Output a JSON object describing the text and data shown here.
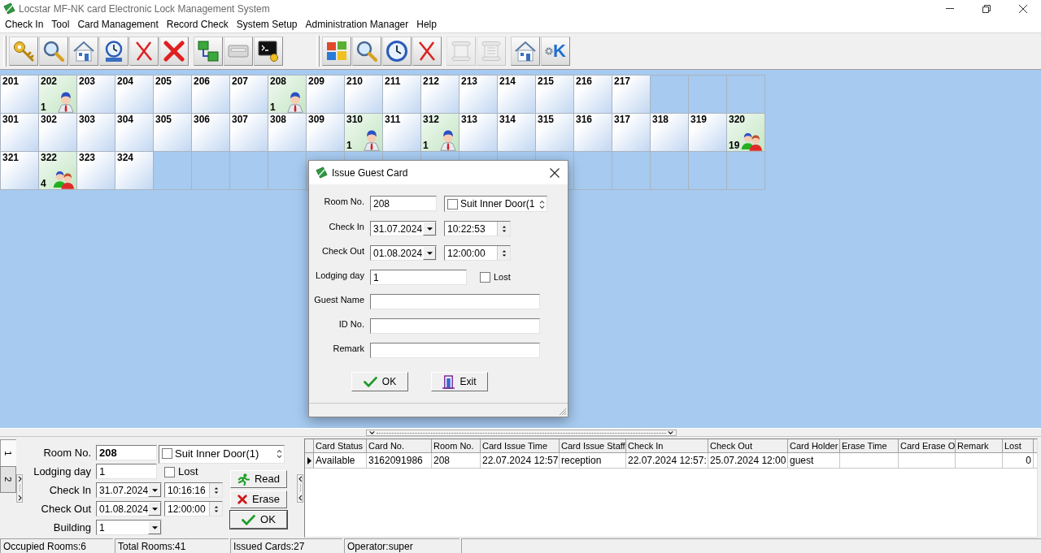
{
  "window": {
    "title": "Locstar MF-NK card Electronic Lock Management System"
  },
  "menu": [
    "Check In",
    "Tool",
    "Card Management",
    "Record Check",
    "System Setup",
    "Administration Manager",
    "Help"
  ],
  "toolbar": [
    {
      "groups": [
        [
          {
            "kind": "keys",
            "disabled": false
          },
          {
            "kind": "search",
            "disabled": false
          },
          {
            "kind": "house",
            "disabled": false
          },
          {
            "kind": "clock-tag",
            "disabled": false
          },
          {
            "kind": "cross-thin",
            "disabled": false
          },
          {
            "kind": "cross-bold",
            "disabled": false
          }
        ],
        [
          {
            "kind": "network",
            "disabled": false
          },
          {
            "kind": "card",
            "disabled": false
          },
          {
            "kind": "terminal",
            "disabled": false
          }
        ]
      ]
    },
    {
      "groups": [
        [
          {
            "kind": "windows",
            "disabled": false
          },
          {
            "kind": "search",
            "disabled": false
          },
          {
            "kind": "clock",
            "disabled": false
          },
          {
            "kind": "cross-thin",
            "disabled": false
          }
        ],
        [
          {
            "kind": "scroll",
            "disabled": true
          },
          {
            "kind": "scroll-list",
            "disabled": true
          }
        ],
        [
          {
            "kind": "house",
            "disabled": false
          },
          {
            "kind": "k-gear",
            "label": "K",
            "disabled": false
          }
        ]
      ]
    }
  ],
  "rooms": [
    [
      {
        "number": "201",
        "kind": "vacant"
      },
      {
        "number": "202",
        "kind": "single",
        "count": "1"
      },
      {
        "number": "203",
        "kind": "vacant"
      },
      {
        "number": "204",
        "kind": "vacant"
      },
      {
        "number": "205",
        "kind": "vacant"
      },
      {
        "number": "206",
        "kind": "vacant"
      },
      {
        "number": "207",
        "kind": "vacant"
      },
      {
        "number": "208",
        "kind": "single",
        "count": "1"
      },
      {
        "number": "209",
        "kind": "vacant"
      },
      {
        "number": "210",
        "kind": "vacant"
      },
      {
        "number": "211",
        "kind": "vacant"
      },
      {
        "number": "212",
        "kind": "vacant"
      },
      {
        "number": "213",
        "kind": "vacant"
      },
      {
        "number": "214",
        "kind": "vacant"
      },
      {
        "number": "215",
        "kind": "vacant"
      },
      {
        "number": "216",
        "kind": "vacant"
      },
      {
        "number": "217",
        "kind": "vacant"
      }
    ],
    [
      {
        "number": "301",
        "kind": "vacant"
      },
      {
        "number": "302",
        "kind": "vacant"
      },
      {
        "number": "303",
        "kind": "vacant"
      },
      {
        "number": "304",
        "kind": "vacant"
      },
      {
        "number": "305",
        "kind": "vacant"
      },
      {
        "number": "306",
        "kind": "vacant"
      },
      {
        "number": "307",
        "kind": "vacant"
      },
      {
        "number": "308",
        "kind": "vacant"
      },
      {
        "number": "309",
        "kind": "vacant"
      },
      {
        "number": "310",
        "kind": "single",
        "count": "1"
      },
      {
        "number": "311",
        "kind": "vacant"
      },
      {
        "number": "312",
        "kind": "single",
        "count": "1"
      },
      {
        "number": "313",
        "kind": "vacant"
      },
      {
        "number": "314",
        "kind": "vacant"
      },
      {
        "number": "315",
        "kind": "vacant"
      },
      {
        "number": "316",
        "kind": "vacant"
      },
      {
        "number": "317",
        "kind": "vacant"
      },
      {
        "number": "318",
        "kind": "vacant"
      },
      {
        "number": "319",
        "kind": "vacant"
      },
      {
        "number": "320",
        "kind": "group",
        "count": "19"
      }
    ],
    [
      {
        "number": "321",
        "kind": "vacant"
      },
      {
        "number": "322",
        "kind": "group",
        "count": "4"
      },
      {
        "number": "323",
        "kind": "vacant"
      },
      {
        "number": "324",
        "kind": "vacant"
      }
    ]
  ],
  "dialog": {
    "title": "Issue Guest Card",
    "room_no": {
      "label": "Room No.",
      "value": "208"
    },
    "suit_inner_door": {
      "label": "Suit Inner Door(1",
      "checked": false
    },
    "check_in": {
      "label": "Check In",
      "date": "31.07.2024",
      "time": "10:22:53"
    },
    "check_out": {
      "label": "Check Out",
      "date": "01.08.2024",
      "time": "12:00:00"
    },
    "lodging_day": {
      "label": "Lodging day",
      "value": "1"
    },
    "lost": {
      "label": "Lost",
      "checked": false
    },
    "guest_name": {
      "label": "Guest Name"
    },
    "id_no": {
      "label": "ID No."
    },
    "remark": {
      "label": "Remark"
    },
    "buttons": [
      {
        "kind": "ok",
        "label": "OK"
      },
      {
        "kind": "exit",
        "label": "Exit"
      }
    ]
  },
  "card_panel": {
    "tabs": [
      {
        "label": "1",
        "selected": true
      },
      {
        "label": "2",
        "selected": false
      }
    ],
    "room_no": {
      "label": "Room No.",
      "value": "208"
    },
    "suit_inner_door": {
      "label": "Suit Inner Door(1)",
      "checked": false
    },
    "lodging_day": {
      "label": "Lodging day",
      "value": "1"
    },
    "lost": {
      "label": "Lost",
      "checked": false
    },
    "check_in": {
      "label": "Check In",
      "date": "31.07.2024",
      "time": "10:16:16"
    },
    "check_out": {
      "label": "Check Out",
      "date": "01.08.2024",
      "time": "12:00:00"
    },
    "building": {
      "label": "Building",
      "value": "1"
    },
    "buttons": [
      {
        "kind": "read",
        "label": "Read"
      },
      {
        "kind": "erase",
        "label": "Erase"
      },
      {
        "kind": "ok",
        "label": "OK"
      }
    ]
  },
  "cards_table": {
    "columns": [
      "Card Status",
      "Card No.",
      "Room No.",
      "Card Issue Time",
      "Card Issue Staff",
      "Check In",
      "Check Out",
      "Card Holder",
      "Erase Time",
      "Card Erase O",
      "Remark",
      "Lost"
    ],
    "rows": [
      {
        "selected": true,
        "cells": [
          "Available",
          "3162091986",
          "208",
          "22.07.2024 12:57",
          "reception",
          "22.07.2024 12:57:",
          "25.07.2024 12:00",
          "guest",
          null,
          null,
          null,
          "0"
        ]
      }
    ]
  },
  "status_bar": [
    "Occupied Rooms:6",
    "Total Rooms:41",
    "Issued Cards:27",
    "Operator:super"
  ]
}
